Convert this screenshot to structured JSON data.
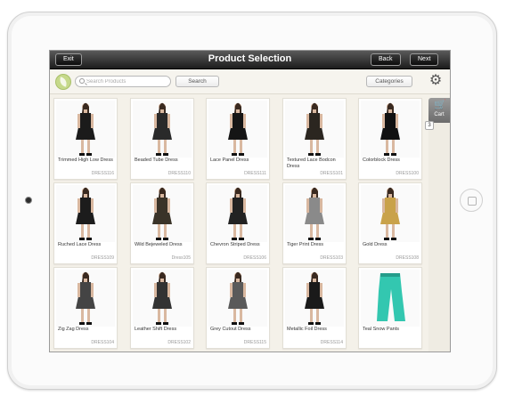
{
  "navbar": {
    "title": "Product Selection",
    "exit_label": "Exit",
    "back_label": "Back",
    "next_label": "Next"
  },
  "toolbar": {
    "search_placeholder": "Search Products",
    "search_label": "Search",
    "categories_label": "Categories",
    "settings_icon": "gear-icon",
    "logo_icon": "leaf-logo-icon"
  },
  "cart": {
    "label": "Cart",
    "count": "3",
    "icon": "cart-icon"
  },
  "products": [
    {
      "name": "Trimmed High Low Dress",
      "code": "DRESS116",
      "dress_color": "#1b1b1b"
    },
    {
      "name": "Beaded Tube Dress",
      "code": "DRESS110",
      "dress_color": "#2a2a2a"
    },
    {
      "name": "Lace Panel Dress",
      "code": "DRESS111",
      "dress_color": "#151515"
    },
    {
      "name": "Textured Lace Bodcon Dress",
      "code": "DRESS101",
      "dress_color": "#2b2620"
    },
    {
      "name": "Colorblock Dress",
      "code": "DRESS100",
      "dress_color": "#111111"
    },
    {
      "name": "Ruched Lace Dress",
      "code": "DRESS109",
      "dress_color": "#1c1c1c"
    },
    {
      "name": "Wild Bejeweled Dress",
      "code": "Dress105",
      "dress_color": "#3a3328"
    },
    {
      "name": "Chevron Striped Dress",
      "code": "DRESS106",
      "dress_color": "#222222"
    },
    {
      "name": "Tiger Print Dress",
      "code": "DRESS103",
      "dress_color": "#8a8a8a"
    },
    {
      "name": "Gold Dress",
      "code": "DRESS108",
      "dress_color": "#c9a24a"
    },
    {
      "name": "Zig Zag Dress",
      "code": "DRESS104",
      "dress_color": "#444444"
    },
    {
      "name": "Leather Shift Dress",
      "code": "DRESS102",
      "dress_color": "#333333"
    },
    {
      "name": "Grey Cutout Dress",
      "code": "DRESS115",
      "dress_color": "#5a5a5a"
    },
    {
      "name": "Metallic Foil Dress",
      "code": "DRESS114",
      "dress_color": "#1a1a1a"
    },
    {
      "name": "Teal Snow Pants",
      "code": "",
      "dress_color": "#33c7b0"
    }
  ]
}
